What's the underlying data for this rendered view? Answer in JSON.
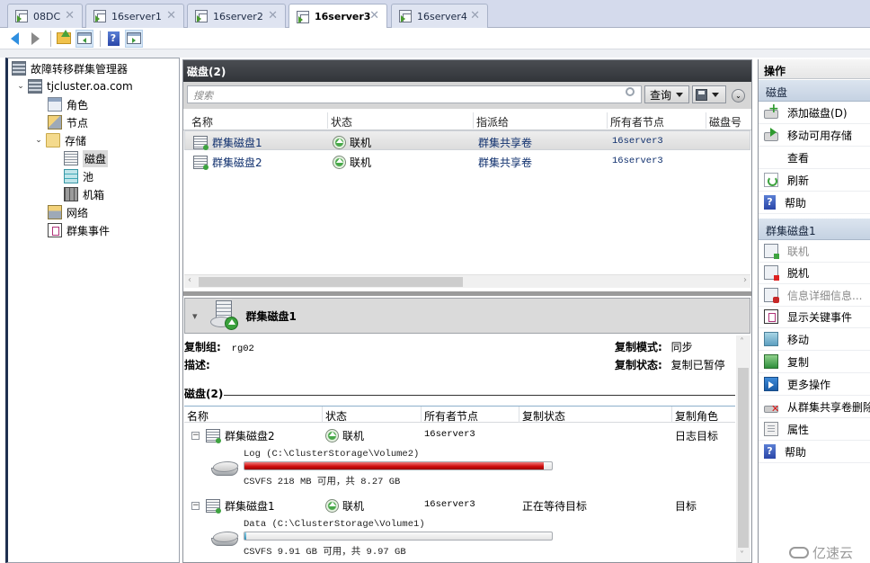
{
  "tabs": [
    {
      "label": "08DC",
      "active": false
    },
    {
      "label": "16server1",
      "active": false
    },
    {
      "label": "16server2",
      "active": false
    },
    {
      "label": "16server3",
      "active": true
    },
    {
      "label": "16server4",
      "active": false
    }
  ],
  "toolbar": {
    "icons": [
      "back-arrow-icon",
      "forward-arrow-icon",
      "up-folder-icon",
      "show-hide-console-tree-icon",
      "help-icon",
      "show-hide-action-pane-icon"
    ]
  },
  "tree": {
    "root": "故障转移群集管理器",
    "cluster": "tjcluster.oa.com",
    "items": {
      "roles": "角色",
      "nodes": "节点",
      "storage": "存储",
      "disks": "磁盘",
      "pools": "池",
      "enclosures": "机箱",
      "networks": "网络",
      "events": "群集事件"
    },
    "selected": "磁盘"
  },
  "disks_panel": {
    "title": "磁盘(2)",
    "search_placeholder": "搜索",
    "query_label": "查询",
    "columns": [
      "名称",
      "状态",
      "指派给",
      "所有者节点",
      "磁盘号"
    ],
    "rows": [
      {
        "name": "群集磁盘1",
        "status": "联机",
        "assigned_to": "群集共享卷",
        "owner_node": "16server3",
        "disk_number": "",
        "selected": true
      },
      {
        "name": "群集磁盘2",
        "status": "联机",
        "assigned_to": "群集共享卷",
        "owner_node": "16server3",
        "disk_number": "",
        "selected": false
      }
    ]
  },
  "detail": {
    "title": "群集磁盘1",
    "replication_group_label": "复制组:",
    "replication_group_value": "rg02",
    "description_label": "描述:",
    "description_value": "",
    "replication_mode_label": "复制模式:",
    "replication_mode_value": "同步",
    "replication_status_label": "复制状态:",
    "replication_status_value": "复制已暂停",
    "section_title": "磁盘(2)",
    "columns": [
      "名称",
      "状态",
      "所有者节点",
      "复制状态",
      "复制角色"
    ],
    "disks": [
      {
        "name": "群集磁盘2",
        "status": "联机",
        "owner_node": "16server3",
        "replication_status": "",
        "replication_role": "日志目标",
        "volume": {
          "label": "Log (C:\\ClusterStorage\\Volume2)",
          "free_text": "CSVFS 218 MB 可用，共 8.27 GB",
          "used_fraction": 0.974,
          "bar_color": "#d10f0f"
        }
      },
      {
        "name": "群集磁盘1",
        "status": "联机",
        "owner_node": "16server3",
        "replication_status": "正在等待目标",
        "replication_role": "目标",
        "volume": {
          "label": "Data (C:\\ClusterStorage\\Volume1)",
          "free_text": "CSVFS 9.91 GB 可用，共 9.97 GB",
          "used_fraction": 0.006,
          "bar_color": "#2f8fb8"
        }
      }
    ]
  },
  "actions": {
    "title": "操作",
    "groups": [
      {
        "label": "磁盘",
        "items": [
          {
            "label": "添加磁盘(D)",
            "icon": "add-disk-icon",
            "enabled": true
          },
          {
            "label": "移动可用存储",
            "icon": "move-storage-icon",
            "enabled": true
          },
          {
            "label": "查看",
            "icon": "",
            "enabled": true
          },
          {
            "label": "刷新",
            "icon": "refresh-icon",
            "enabled": true
          },
          {
            "label": "帮助",
            "icon": "help-icon",
            "enabled": true
          }
        ]
      },
      {
        "label": "群集磁盘1",
        "items": [
          {
            "label": "联机",
            "icon": "bring-online-icon",
            "enabled": false
          },
          {
            "label": "脱机",
            "icon": "take-offline-icon",
            "enabled": true
          },
          {
            "label": "信息详细信息...",
            "icon": "information-details-icon",
            "enabled": false
          },
          {
            "label": "显示关键事件",
            "icon": "critical-events-icon",
            "enabled": true
          },
          {
            "label": "移动",
            "icon": "move-icon",
            "enabled": true
          },
          {
            "label": "复制",
            "icon": "replication-icon",
            "enabled": true
          },
          {
            "label": "更多操作",
            "icon": "more-actions-icon",
            "enabled": true
          },
          {
            "label": "从群集共享卷删除",
            "icon": "remove-from-csv-icon",
            "enabled": true
          },
          {
            "label": "属性",
            "icon": "properties-icon",
            "enabled": true
          },
          {
            "label": "帮助",
            "icon": "help-icon",
            "enabled": true
          }
        ]
      }
    ]
  },
  "watermark": "亿速云"
}
